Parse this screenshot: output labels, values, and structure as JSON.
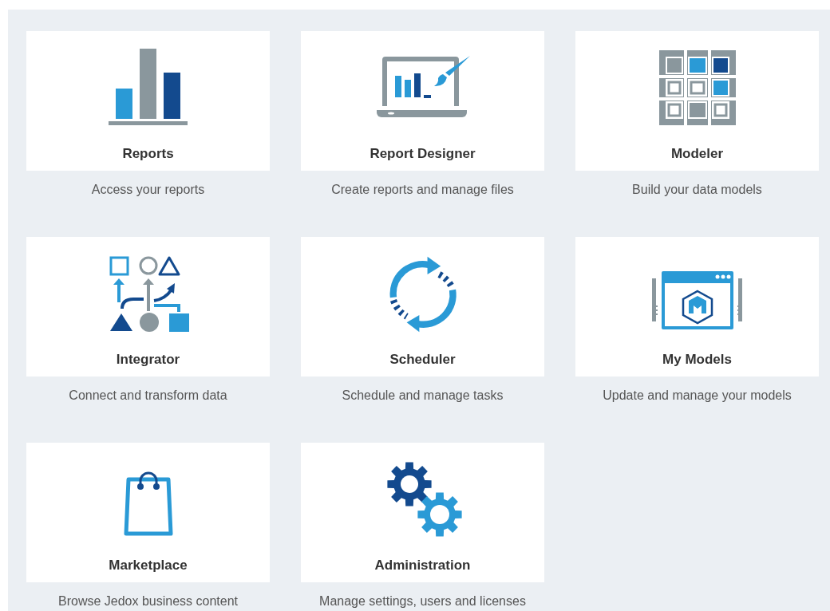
{
  "tiles": [
    {
      "kind": "reports",
      "title": "Reports",
      "description": "Access your reports"
    },
    {
      "kind": "designer",
      "title": "Report Designer",
      "description": "Create reports and manage files"
    },
    {
      "kind": "modeler",
      "title": "Modeler",
      "description": "Build your data models"
    },
    {
      "kind": "integrator",
      "title": "Integrator",
      "description": "Connect and transform data"
    },
    {
      "kind": "scheduler",
      "title": "Scheduler",
      "description": "Schedule and manage tasks"
    },
    {
      "kind": "models",
      "title": "My Models",
      "description": "Update and manage your models"
    },
    {
      "kind": "marketplace",
      "title": "Marketplace",
      "description": "Browse Jedox business content"
    },
    {
      "kind": "admin",
      "title": "Administration",
      "description": "Manage settings, users and licenses"
    }
  ]
}
